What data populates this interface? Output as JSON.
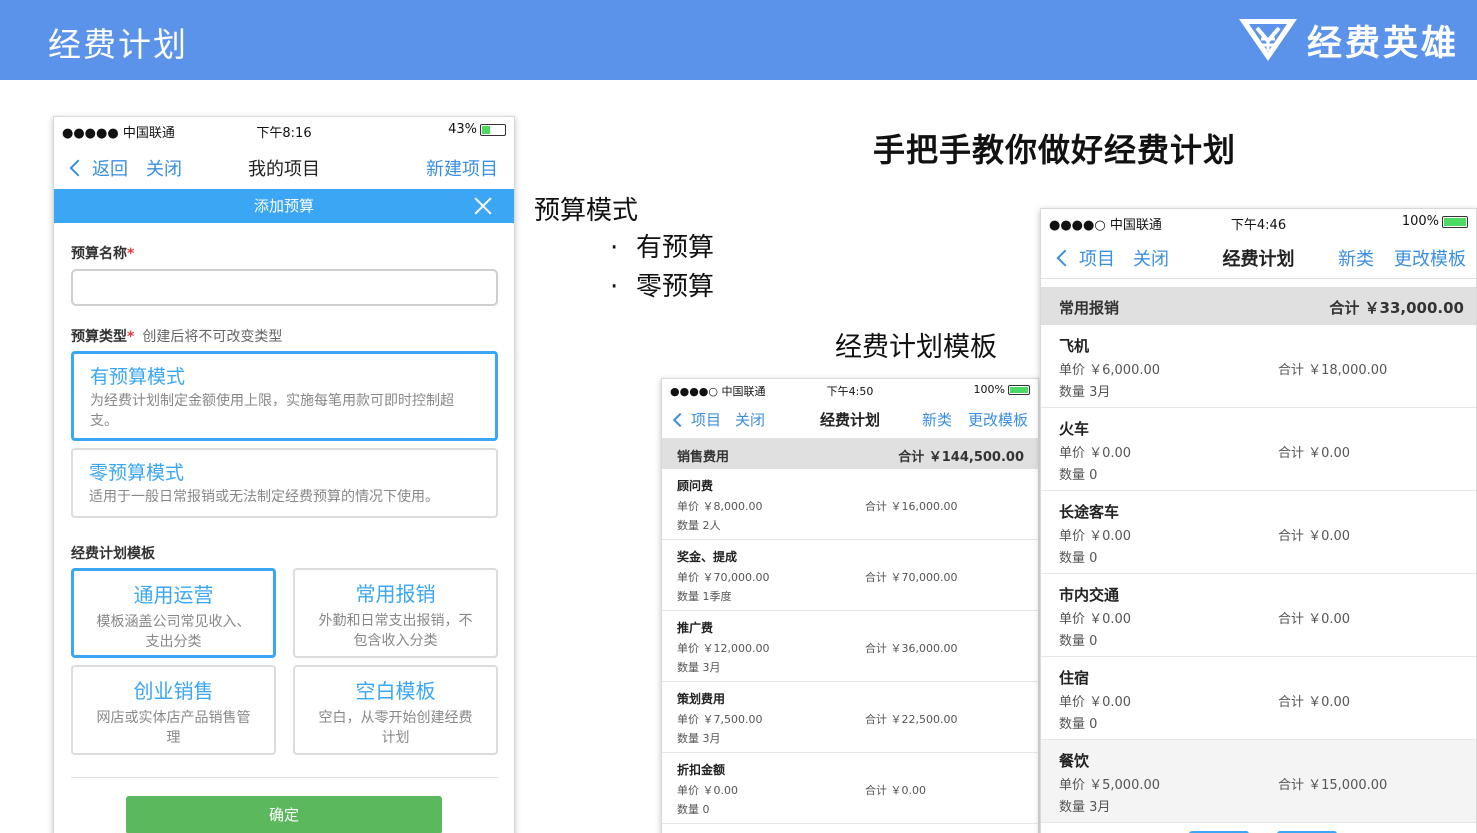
{
  "banner": {
    "title": "经费计划",
    "brand_name": "经费英雄"
  },
  "slide": {
    "heading": "手把手教你做好经费计划",
    "mode_title": "预算模式",
    "mode_bullets": [
      "有预算",
      "零预算"
    ],
    "bullet_glyph": "·",
    "template_label": "经费计划模板"
  },
  "colors": {
    "banner": "#5b92ea",
    "accent": "#3aa6f4",
    "confirm": "#5cb85c",
    "required": "#e03a3a"
  },
  "phone1": {
    "status": {
      "carrier": "●●●●● 中国联通",
      "time": "下午8:16",
      "battery": "43%",
      "battery_level": 0.43
    },
    "nav": {
      "back": "返回",
      "close": "关闭",
      "title": "我的项目",
      "action": "新建项目"
    },
    "modal": {
      "title": "添加预算",
      "name_label": "预算名称",
      "required_mark": "*",
      "name_value": "",
      "type_label": "预算类型",
      "type_hint": "创建后将不可改变类型",
      "modes": [
        {
          "title": "有预算模式",
          "desc": "为经费计划制定金额使用上限，实施每笔用款可即时控制超支。",
          "selected": true
        },
        {
          "title": "零预算模式",
          "desc": "适用于一般日常报销或无法制定经费预算的情况下使用。",
          "selected": false
        }
      ],
      "template_label": "经费计划模板",
      "templates": [
        {
          "title": "通用运营",
          "desc": "模板涵盖公司常见收入、支出分类",
          "selected": true
        },
        {
          "title": "常用报销",
          "desc": "外勤和日常支出报销，不包含收入分类",
          "selected": false
        },
        {
          "title": "创业销售",
          "desc": "网店或实体店产品销售管理",
          "selected": false
        },
        {
          "title": "空白模板",
          "desc": "空白，从零开始创建经费计划",
          "selected": false
        }
      ],
      "confirm": "确定"
    }
  },
  "phone2": {
    "status": {
      "carrier": "●●●●○ 中国联通",
      "time": "下午4:50",
      "battery": "100%",
      "battery_level": 1.0
    },
    "nav": {
      "back": "项目",
      "close": "关闭",
      "title": "经费计划",
      "action1": "新类",
      "action2": "更改模板"
    },
    "section": {
      "name": "销售费用",
      "total": "合计 ￥144,500.00"
    },
    "items": [
      {
        "name": "顾问费",
        "price": "单价 ￥8,000.00",
        "total": "合计 ￥16,000.00",
        "qty": "数量 2人"
      },
      {
        "name": "奖金、提成",
        "price": "单价 ￥70,000.00",
        "total": "合计 ￥70,000.00",
        "qty": "数量 1季度"
      },
      {
        "name": "推广费",
        "price": "单价 ￥12,000.00",
        "total": "合计 ￥36,000.00",
        "qty": "数量 3月"
      },
      {
        "name": "策划费用",
        "price": "单价 ￥7,500.00",
        "total": "合计 ￥22,500.00",
        "qty": "数量 3月"
      },
      {
        "name": "折扣金额",
        "price": "单价 ￥0.00",
        "total": "合计 ￥0.00",
        "qty": "数量 0"
      }
    ]
  },
  "phone3": {
    "status": {
      "carrier": "●●●●○ 中国联通",
      "time": "下午4:46",
      "battery": "100%",
      "battery_level": 1.0
    },
    "nav": {
      "back": "项目",
      "close": "关闭",
      "title": "经费计划",
      "action1": "新类",
      "action2": "更改模板"
    },
    "section": {
      "name": "常用报销",
      "total": "合计 ￥33,000.00"
    },
    "items": [
      {
        "name": "飞机",
        "price": "单价 ￥6,000.00",
        "total": "合计 ￥18,000.00",
        "qty": "数量 3月"
      },
      {
        "name": "火车",
        "price": "单价 ￥0.00",
        "total": "合计 ￥0.00",
        "qty": "数量 0"
      },
      {
        "name": "长途客车",
        "price": "单价 ￥0.00",
        "total": "合计 ￥0.00",
        "qty": "数量 0"
      },
      {
        "name": "市内交通",
        "price": "单价 ￥0.00",
        "total": "合计 ￥0.00",
        "qty": "数量 0"
      },
      {
        "name": "住宿",
        "price": "单价 ￥0.00",
        "total": "合计 ￥0.00",
        "qty": "数量 0"
      },
      {
        "name": "餐饮",
        "price": "单价 ￥5,000.00",
        "total": "合计 ￥15,000.00",
        "qty": "数量 3月"
      }
    ]
  }
}
